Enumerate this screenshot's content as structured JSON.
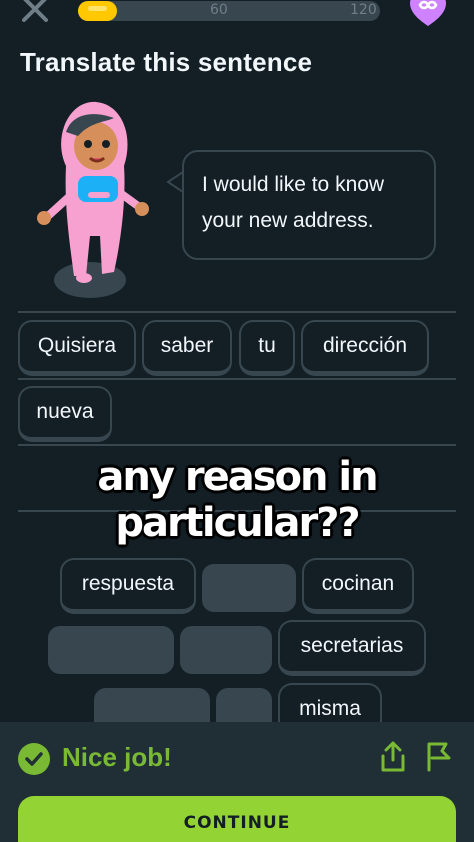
{
  "header": {
    "close_icon": "close-icon",
    "progress_fraction": 0.13,
    "progress_marks": [
      "60",
      "120"
    ],
    "hearts_icon": "infinity-heart-icon",
    "colors": {
      "progress": "#ffc800",
      "heart": "#ce82ff"
    }
  },
  "exercise": {
    "title": "Translate this sentence",
    "prompt": "I would like to know your new address.",
    "prompt_lines": [
      "I would like to know",
      "your new address."
    ]
  },
  "answer": {
    "tokens": [
      "Quisiera",
      "saber",
      "tu",
      "dirección",
      "nueva"
    ]
  },
  "overlay_caption": "any reason in particular??",
  "word_bank": {
    "visible_words": [
      "respuesta",
      "cocinan",
      "secretarias",
      "misma"
    ]
  },
  "feedback": {
    "status_icon": "checkmark-icon",
    "message": "Nice job!",
    "share_icon": "share-icon",
    "report_icon": "flag-icon",
    "continue_label": "CONTINUE",
    "colors": {
      "success": "#79b933",
      "button": "#93d333"
    }
  }
}
